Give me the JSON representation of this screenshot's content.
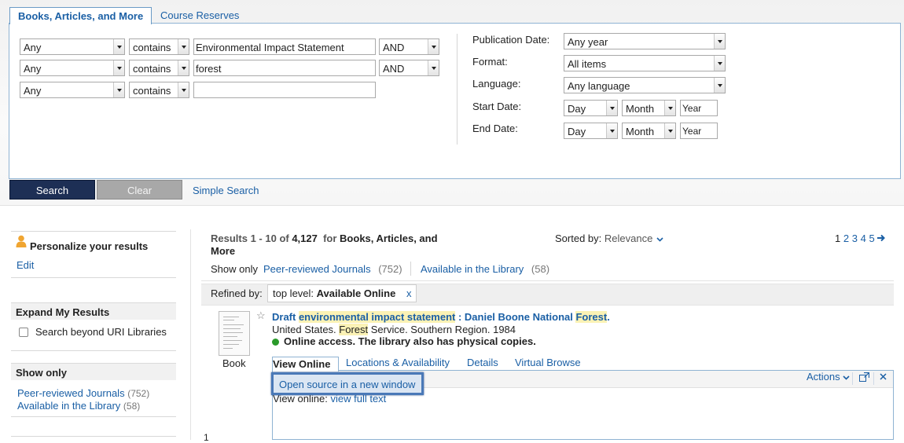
{
  "tabs": {
    "books": "Books, Articles, and More",
    "reserves": "Course Reserves"
  },
  "advanced_search": {
    "rows": [
      {
        "field": "Any",
        "operator": "contains",
        "term": "Environmental Impact Statement",
        "bool": "AND"
      },
      {
        "field": "Any",
        "operator": "contains",
        "term": "forest",
        "bool": "AND"
      },
      {
        "field": "Any",
        "operator": "contains",
        "term": ""
      }
    ],
    "filters": {
      "pub_date_label": "Publication Date:",
      "pub_date_value": "Any year",
      "format_label": "Format:",
      "format_value": "All items",
      "language_label": "Language:",
      "language_value": "Any language",
      "start_label": "Start Date:",
      "end_label": "End Date:",
      "day": "Day",
      "month": "Month",
      "year_placeholder": "Year"
    },
    "search_button": "Search",
    "clear_button": "Clear",
    "simple_search_link": "Simple Search"
  },
  "sidebar": {
    "personalize_title": "Personalize your results",
    "personalize_edit": "Edit",
    "expand_title": "Expand My Results",
    "expand_option": "Search beyond URI Libraries",
    "show_only_title": "Show only",
    "show_only_items": [
      {
        "label": "Peer-reviewed Journals",
        "count": "(752)"
      },
      {
        "label": "Available in the Library",
        "count": "(58)"
      }
    ]
  },
  "results": {
    "summary_prefix": "Results ",
    "range": "1 - 10",
    "of": " of ",
    "total": "4,127",
    "for_label": "  for ",
    "scope_line1": "Books, Articles, and",
    "scope_line2": "More",
    "sorted_label": "Sorted by:",
    "sorted_value": "Relevance",
    "pages": [
      "1",
      "2",
      "3",
      "4",
      "5"
    ],
    "show_only_label": "Show only",
    "show_only_links": [
      {
        "label": "Peer-reviewed Journals",
        "count": "(752)"
      },
      {
        "label": "Available in the Library",
        "count": "(58)"
      }
    ],
    "refined_label": "Refined by:",
    "refined_chip_prefix": "top level: ",
    "refined_chip_value": "Available Online",
    "refined_chip_remove": "x"
  },
  "record": {
    "type_label": "Book",
    "title_parts": [
      "Draft ",
      "environmental impact statement",
      " : Daniel Boone National ",
      "Forest",
      "."
    ],
    "author_parts": [
      "United States. ",
      "Forest",
      " Service. Southern Region. 1984"
    ],
    "availability": "Online access. The library also has physical copies.",
    "tabs": [
      "View Online",
      "Locations & Availability",
      "Details",
      "Virtual Browse"
    ],
    "actions_label": "Actions",
    "open_source_link": "Open source in a new window",
    "view_online_label": "View online: ",
    "view_full_text": "view full text",
    "next_record_number": "1"
  },
  "colors": {
    "link": "#1a5fa5",
    "search_button": "#1d2f55",
    "highlight": "#fbf2b5",
    "focus_border": "#4a79b8"
  }
}
